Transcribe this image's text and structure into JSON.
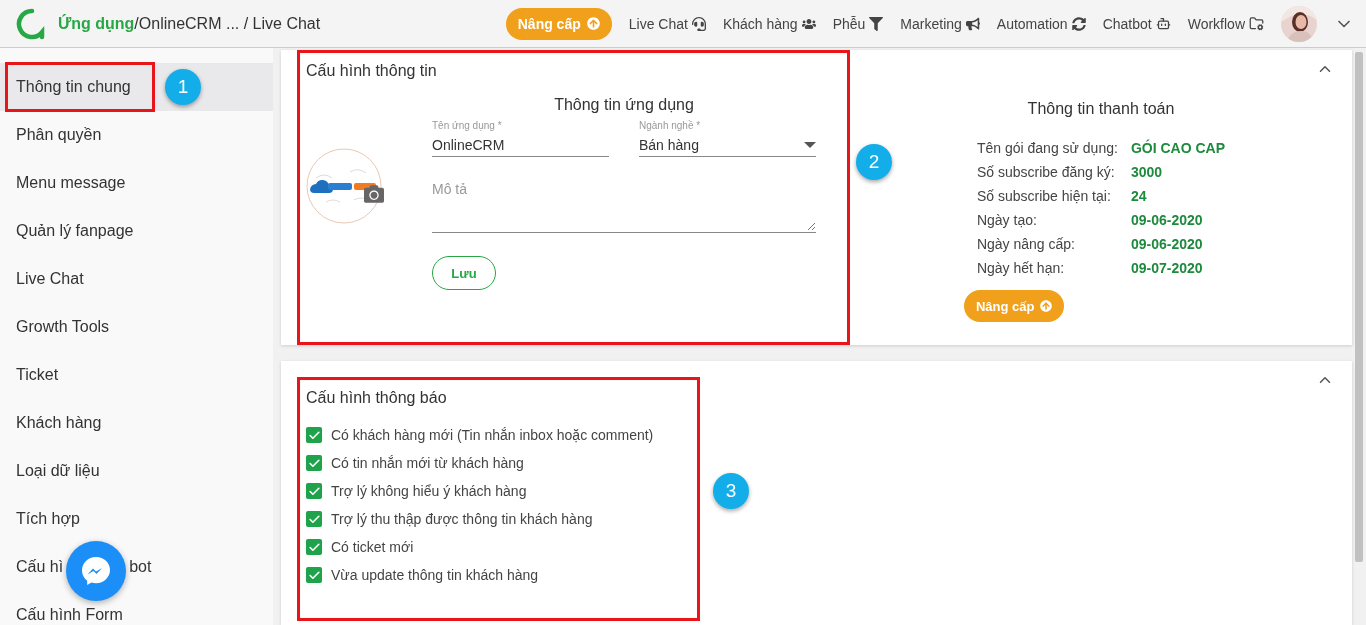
{
  "topbar": {
    "breadcrumb": {
      "root": "Ứng dụng",
      "app": "/OnlineCRM ...",
      "page": " / Live Chat"
    },
    "upgrade_button": "Nâng cấp",
    "nav": [
      {
        "label": "Live Chat"
      },
      {
        "label": "Khách hàng"
      },
      {
        "label": "Phễu"
      },
      {
        "label": "Marketing"
      },
      {
        "label": "Automation"
      },
      {
        "label": "Chatbot"
      },
      {
        "label": "Workflow"
      }
    ]
  },
  "sidebar": {
    "items": [
      {
        "label": "Thông tin chung",
        "selected": true,
        "highlighted": true,
        "marker": "1"
      },
      {
        "label": "Phân quyền",
        "selected": false,
        "highlighted": false
      },
      {
        "label": "Menu message",
        "selected": false,
        "highlighted": false
      },
      {
        "label": "Quản lý fanpage",
        "selected": false,
        "highlighted": false
      },
      {
        "label": "Live Chat",
        "selected": false,
        "highlighted": false
      },
      {
        "label": "Growth Tools",
        "selected": false,
        "highlighted": false
      },
      {
        "label": "Ticket",
        "selected": false,
        "highlighted": false
      },
      {
        "label": "Khách hàng",
        "selected": false,
        "highlighted": false
      },
      {
        "label": "Loại dữ liệu",
        "selected": false,
        "highlighted": false
      },
      {
        "label": "Tích hợp",
        "selected": false,
        "highlighted": false
      },
      {
        "label": "Cấu hì",
        "label_after": "bot",
        "selected": false,
        "highlighted": false
      },
      {
        "label": "Cấu hình Form",
        "selected": false,
        "highlighted": false
      }
    ]
  },
  "info_section": {
    "title": "Cấu hình thông tin",
    "expanded": true,
    "highlighted": true,
    "marker": "2",
    "app_info": {
      "heading": "Thông tin ứng dụng",
      "name_field": {
        "label": "Tên ứng dụng *",
        "value": "OnlineCRM"
      },
      "industry_field": {
        "label": "Ngành nghề  *",
        "value": "Bán hàng"
      },
      "description_field": {
        "placeholder": "Mô tả"
      },
      "save_button": "Lưu"
    },
    "payment": {
      "heading": "Thông tin thanh toán",
      "rows": [
        {
          "label": "Tên gói đang sử dụng:",
          "value": "GÓI CAO CAP"
        },
        {
          "label": "Số subscribe đăng ký:",
          "value": "3000"
        },
        {
          "label": "Số subscribe hiện tại:",
          "value": "24"
        },
        {
          "label": "Ngày tạo:",
          "value": "09-06-2020"
        },
        {
          "label": "Ngày nâng cấp:",
          "value": "09-06-2020"
        },
        {
          "label": "Ngày hết hạn:",
          "value": "09-07-2020"
        }
      ],
      "upgrade_button": "Nâng cấp"
    }
  },
  "notify_section": {
    "title": "Cấu hình thông báo",
    "expanded": true,
    "highlighted": true,
    "marker": "3",
    "items": [
      {
        "label": "Có khách hàng mới (Tin nhắn inbox hoặc comment)",
        "checked": true
      },
      {
        "label": "Có tin nhắn mới từ khách hàng",
        "checked": true
      },
      {
        "label": "Trợ lý không hiểu ý khách hàng",
        "checked": true
      },
      {
        "label": "Trợ lý thu thập được thông tin khách hàng",
        "checked": true
      },
      {
        "label": "Có ticket mới",
        "checked": true
      },
      {
        "label": "Vừa update thông tin khách hàng",
        "checked": true
      }
    ]
  }
}
